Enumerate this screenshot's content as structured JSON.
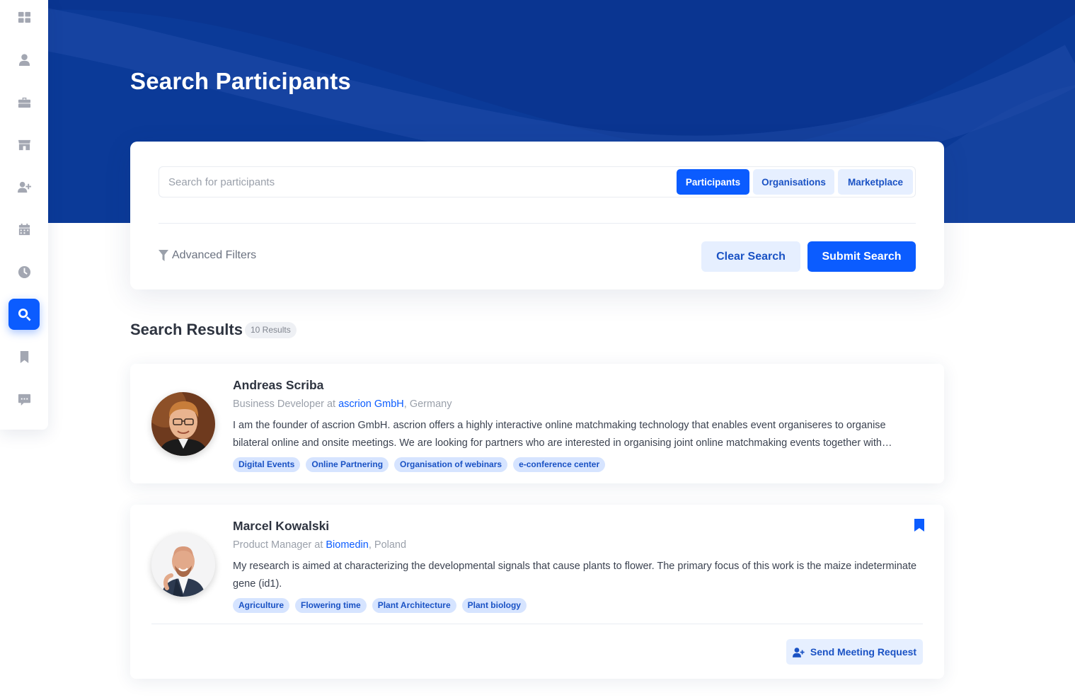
{
  "colors": {
    "hero": "#0b3a98",
    "accent": "#0b5cff",
    "accent_light": "#e6efff",
    "tag_bg": "#d6e4ff"
  },
  "sidebar": {
    "items": [
      {
        "name": "dashboard-icon",
        "active": false
      },
      {
        "name": "user-icon",
        "active": false
      },
      {
        "name": "briefcase-icon",
        "active": false
      },
      {
        "name": "store-icon",
        "active": false
      },
      {
        "name": "user-plus-icon",
        "active": false
      },
      {
        "name": "calendar-icon",
        "active": false
      },
      {
        "name": "clock-icon",
        "active": false
      },
      {
        "name": "search-icon",
        "active": true
      },
      {
        "name": "bookmark-icon",
        "active": false
      },
      {
        "name": "chat-icon",
        "active": false
      }
    ]
  },
  "page": {
    "title": "Search Participants"
  },
  "search": {
    "placeholder": "Search for participants",
    "value": "",
    "scopes": [
      "Participants",
      "Organisations",
      "Marketplace"
    ],
    "active_scope": "Participants",
    "advanced_filters_label": "Advanced Filters",
    "clear_label": "Clear Search",
    "submit_label": "Submit Search"
  },
  "results": {
    "title": "Search Results",
    "count_label": "10 Results",
    "items": [
      {
        "name": "Andreas Scriba",
        "role_prefix": "Business Developer at ",
        "organisation": "ascrion GmbH",
        "country_suffix": ", Germany",
        "bio": "I am the founder of ascrion GmbH. ascrion offers a highly interactive online matchmaking technology that enables event organiseres to organise bilateral online and onsite meetings. We are looking for partners who are interested in organising joint online matchmaking events together with…",
        "tags": [
          "Digital Events",
          "Online Partnering",
          "Organisation of webinars",
          "e-conference center"
        ],
        "bookmarked": false
      },
      {
        "name": "Marcel Kowalski",
        "role_prefix": "Product Manager at ",
        "organisation": "Biomedin",
        "country_suffix": ", Poland",
        "bio": "My research is aimed at characterizing the developmental signals that cause plants to flower. The primary focus of this work is the maize indeterminate gene (id1).",
        "tags": [
          "Agriculture",
          "Flowering time",
          "Plant Architecture",
          "Plant biology"
        ],
        "bookmarked": true,
        "action_label": "Send Meeting Request"
      }
    ]
  }
}
